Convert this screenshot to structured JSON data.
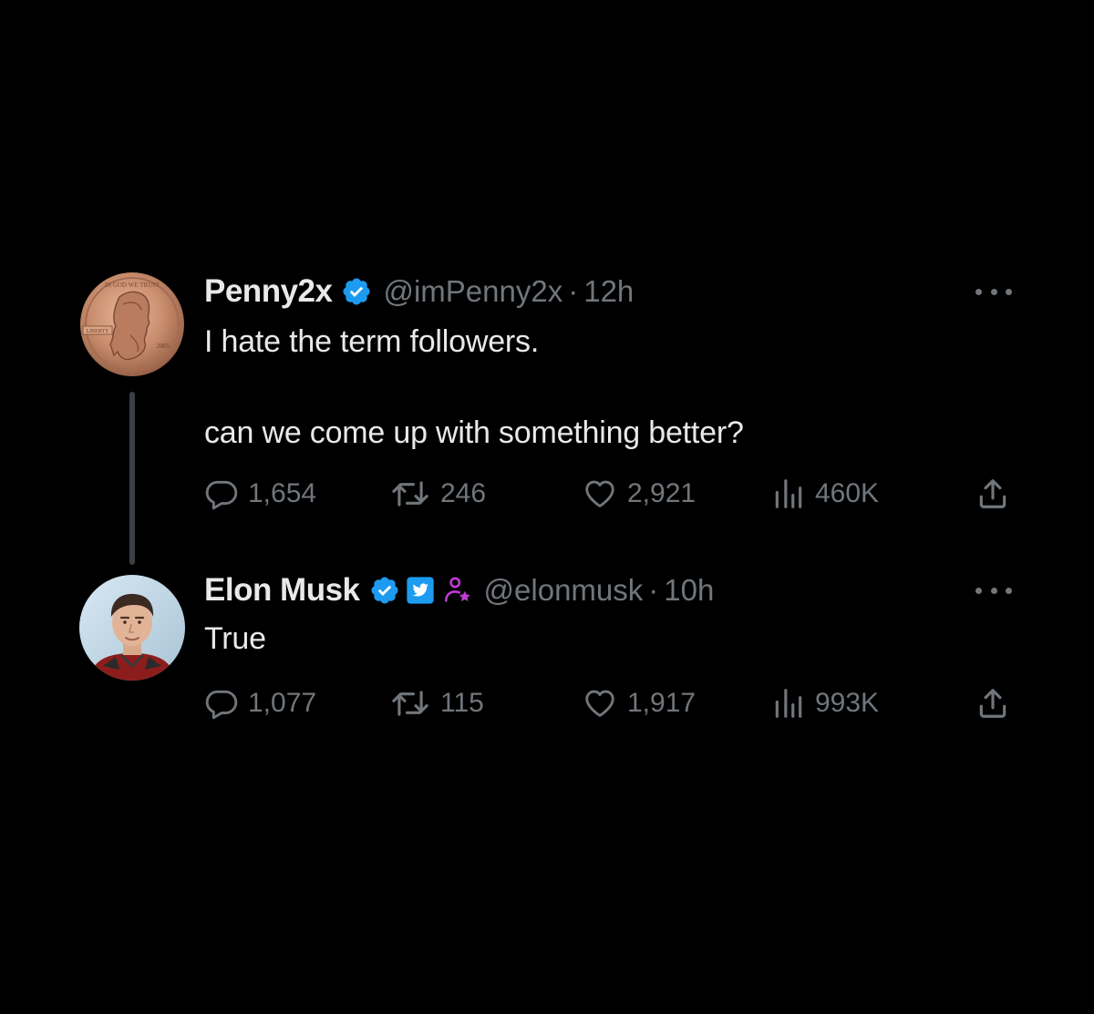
{
  "colors": {
    "background": "#000000",
    "text": "#e7e9ea",
    "muted": "#71767b",
    "verified_blue": "#1d9bf0",
    "affiliate_pink": "#c13bd6"
  },
  "tweets": [
    {
      "display_name": "Penny2x",
      "handle": "@imPenny2x",
      "separator": "·",
      "time": "12h",
      "badges": [
        "verified-icon"
      ],
      "avatar": "penny-coin-avatar",
      "avatar_lettering": [
        "IN GOD WE TRUST",
        "LIBERTY",
        "2005"
      ],
      "text_line1": "I hate the term followers.",
      "text_line2": "can we come up with something better?",
      "stats": {
        "replies": "1,654",
        "reposts": "246",
        "likes": "2,921",
        "views": "460K"
      }
    },
    {
      "display_name": "Elon Musk",
      "handle": "@elonmusk",
      "separator": "·",
      "time": "10h",
      "badges": [
        "verified-icon",
        "twitter-bird-badge-icon",
        "affiliate-icon"
      ],
      "avatar": "elon-musk-avatar",
      "text_line1": "True",
      "stats": {
        "replies": "1,077",
        "reposts": "115",
        "likes": "1,917",
        "views": "993K"
      }
    }
  ]
}
